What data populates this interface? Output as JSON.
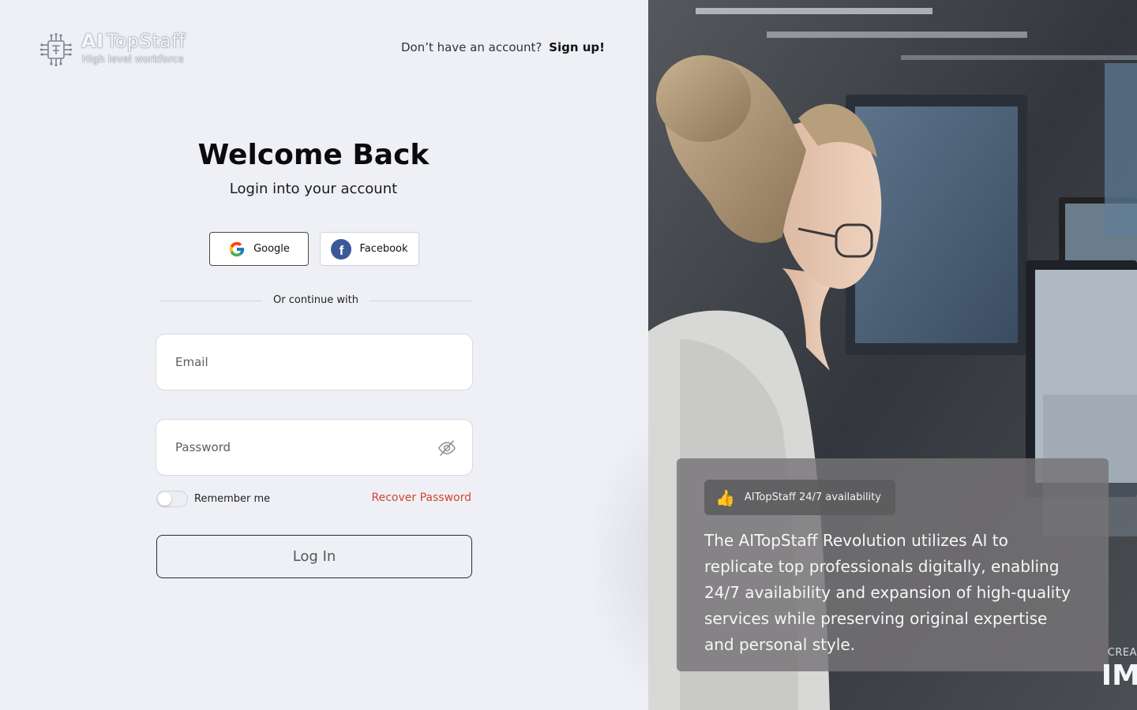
{
  "brand": {
    "name_ai": "AI",
    "name_rest": "TopStaff",
    "tagline": "High level workforce"
  },
  "header": {
    "signup_prompt": "Don’t have an account?",
    "signup_link": "Sign up!"
  },
  "login": {
    "title": "Welcome Back",
    "subtitle": "Login into your account",
    "social": {
      "google_label": "Google",
      "facebook_label": "Facebook",
      "facebook_glyph": "f"
    },
    "divider_text": "Or continue with",
    "email_placeholder": "Email",
    "password_placeholder": "Password",
    "remember_label": "Remember me",
    "recover_label": "Recover Password",
    "submit_label": "Log In"
  },
  "promo": {
    "pill_label": "AITopStaff 24/7 availability",
    "pill_icon": "👍",
    "body": "The AITopStaff Revolution utilizes AI to replicate top professionals digitally, enabling 24/7 availability and expansion of high-quality services while preserving original expertise and personal style.",
    "watermark_top": "CREA",
    "watermark_bottom": "IM"
  },
  "colors": {
    "accent_link": "#d0452f",
    "facebook_blue": "#3b5998",
    "page_bg": "#eff0f5"
  }
}
